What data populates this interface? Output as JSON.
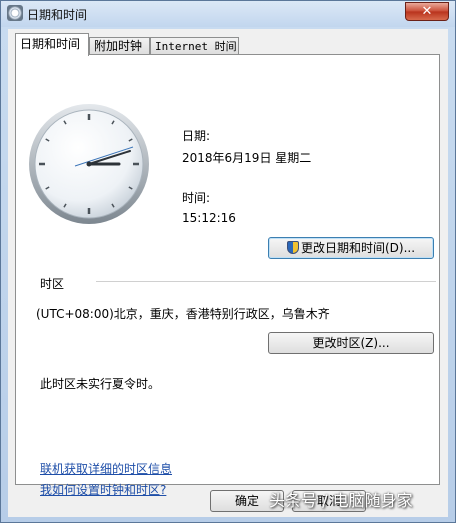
{
  "window": {
    "title": "日期和时间",
    "close_label": "✕"
  },
  "tabs": [
    {
      "label": "日期和时间",
      "active": true
    },
    {
      "label": "附加时钟",
      "active": false
    },
    {
      "label": "Internet 时间",
      "active": false
    }
  ],
  "clock_section": {
    "date_label": "日期:",
    "date_value": "2018年6月19日 星期二",
    "time_label": "时间:",
    "time_value": "15:12:16",
    "change_datetime_button": "更改日期和时间(D)..."
  },
  "timezone_section": {
    "heading": "时区",
    "zone_value": "(UTC+08:00)北京，重庆，香港特别行政区，乌鲁木齐",
    "change_zone_button": "更改时区(Z)...",
    "dst_note": "此时区未实行夏令时。"
  },
  "links": {
    "online_info": "联机获取详细的时区信息",
    "how_to": "我如何设置时钟和时区?"
  },
  "footer": {
    "ok_label": "确定",
    "cancel_label": "取消"
  },
  "watermark": "头条号 / 电脑随身家",
  "colors": {
    "link": "#1e4ea8",
    "titlebar": "#c2d6ee",
    "close": "#c94b34"
  },
  "icons": {
    "title": "clock-icon",
    "close": "close-icon",
    "uac": "shield-icon"
  }
}
